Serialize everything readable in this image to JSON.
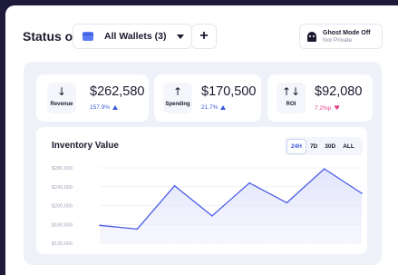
{
  "header": {
    "status_label": "Status of",
    "wallet_select": "All Wallets (3)",
    "add_button": "+",
    "ghost_title": "Ghost Mode Off",
    "ghost_subtitle": "Not Private"
  },
  "stats": [
    {
      "label": "Revenue",
      "value": "$262,580",
      "change": "157.9%",
      "arrow": "↓",
      "trend": "up",
      "color": "#3d5ad9"
    },
    {
      "label": "Spending",
      "value": "$170,500",
      "change": "21.7%",
      "arrow": "↑",
      "trend": "up",
      "color": "#3d5ad9"
    },
    {
      "label": "ROI",
      "value": "$92,080",
      "change": "7.2%p",
      "arrow": "↑↓",
      "trend": "heart",
      "color": "#e0458b"
    }
  ],
  "chart": {
    "title": "Inventory Value",
    "ranges": [
      "24H",
      "7D",
      "30D",
      "ALL"
    ],
    "active_range": "24H"
  },
  "chart_data": {
    "type": "area",
    "title": "Inventory Value",
    "xlabel": "",
    "ylabel": "",
    "yticks": [
      "$280,000",
      "$240,000",
      "$200,000",
      "$160,000",
      "$120,000"
    ],
    "ylim": [
      120000,
      280000
    ],
    "grid": true,
    "x": [
      0,
      1,
      2,
      3,
      4,
      5,
      6,
      7
    ],
    "series": [
      {
        "values": [
          158000,
          150000,
          242000,
          178000,
          248000,
          206000,
          278000,
          226000
        ]
      }
    ],
    "colors": {
      "line": "#4b5ce6",
      "fill": "#dfe3fb"
    }
  }
}
